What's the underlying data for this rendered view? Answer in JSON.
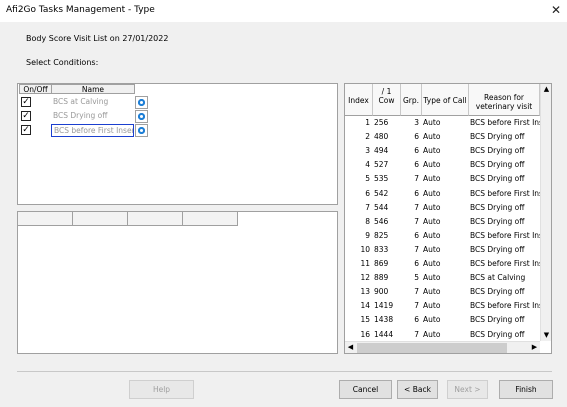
{
  "window": {
    "title": "Afi2Go Tasks Management - Type",
    "close_glyph": "✕"
  },
  "subtitle": "Body Score Visit List on 27/01/2022",
  "conditions_label": "Select Conditions:",
  "conditions": {
    "headers": {
      "onoff": "On/Off",
      "name": "Name"
    },
    "items": [
      {
        "checked": true,
        "check_glyph": "✓",
        "name": "BCS at Calving",
        "selected": false
      },
      {
        "checked": true,
        "check_glyph": "✓",
        "name": "BCS Drying off",
        "selected": false
      },
      {
        "checked": true,
        "check_glyph": "✓",
        "name": "BCS before First Insem",
        "selected": true
      }
    ]
  },
  "table": {
    "headers": {
      "index": "Index",
      "cow_top": "/ 1",
      "cow": "Cow",
      "grp": "Grp.",
      "type": "Type of Call",
      "reason_1": "Reason for",
      "reason_2": "veterinary visit"
    },
    "rows": [
      {
        "index": "1",
        "cow": "256",
        "grp": "3",
        "type": "Auto",
        "reason": "BCS before First Ins"
      },
      {
        "index": "2",
        "cow": "480",
        "grp": "6",
        "type": "Auto",
        "reason": "BCS Drying off"
      },
      {
        "index": "3",
        "cow": "494",
        "grp": "6",
        "type": "Auto",
        "reason": "BCS Drying off"
      },
      {
        "index": "4",
        "cow": "527",
        "grp": "6",
        "type": "Auto",
        "reason": "BCS Drying off"
      },
      {
        "index": "5",
        "cow": "535",
        "grp": "7",
        "type": "Auto",
        "reason": "BCS Drying off"
      },
      {
        "index": "6",
        "cow": "542",
        "grp": "6",
        "type": "Auto",
        "reason": "BCS before First Ins"
      },
      {
        "index": "7",
        "cow": "544",
        "grp": "7",
        "type": "Auto",
        "reason": "BCS Drying off"
      },
      {
        "index": "8",
        "cow": "546",
        "grp": "7",
        "type": "Auto",
        "reason": "BCS Drying off"
      },
      {
        "index": "9",
        "cow": "825",
        "grp": "6",
        "type": "Auto",
        "reason": "BCS before First Ins"
      },
      {
        "index": "10",
        "cow": "833",
        "grp": "7",
        "type": "Auto",
        "reason": "BCS Drying off"
      },
      {
        "index": "11",
        "cow": "869",
        "grp": "6",
        "type": "Auto",
        "reason": "BCS before First Ins"
      },
      {
        "index": "12",
        "cow": "889",
        "grp": "5",
        "type": "Auto",
        "reason": "BCS at Calving"
      },
      {
        "index": "13",
        "cow": "900",
        "grp": "7",
        "type": "Auto",
        "reason": "BCS Drying off"
      },
      {
        "index": "14",
        "cow": "1419",
        "grp": "7",
        "type": "Auto",
        "reason": "BCS before First Ins"
      },
      {
        "index": "15",
        "cow": "1438",
        "grp": "6",
        "type": "Auto",
        "reason": "BCS Drying off"
      },
      {
        "index": "16",
        "cow": "1444",
        "grp": "7",
        "type": "Auto",
        "reason": "BCS Drying off"
      }
    ],
    "scroll": {
      "up": "▲",
      "down": "▼",
      "left": "◀",
      "right": "▶"
    }
  },
  "buttons": {
    "help": "Help",
    "cancel": "Cancel",
    "back": "< Back",
    "next": "Next >",
    "finish": "Finish"
  }
}
